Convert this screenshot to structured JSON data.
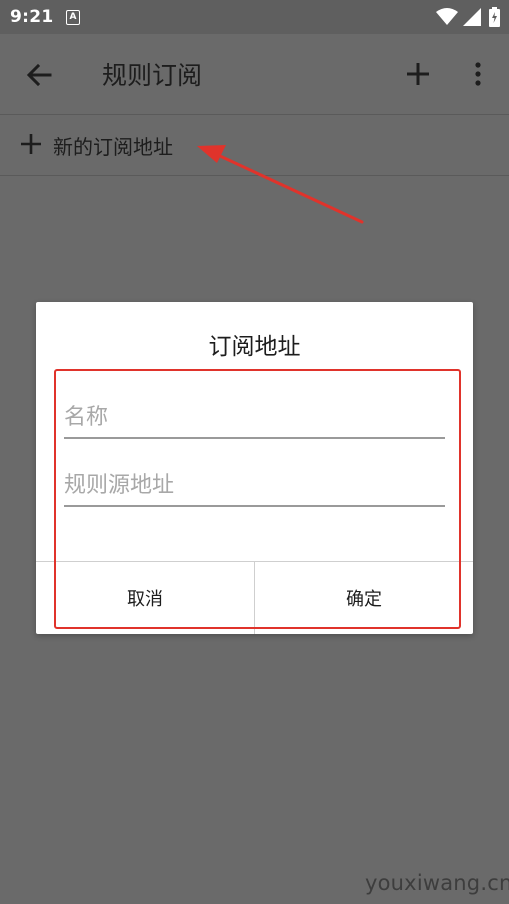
{
  "status_bar": {
    "time": "9:21",
    "notification_icon_letter": "A",
    "icons": [
      "a-notification-icon",
      "wifi-icon",
      "signal-icon",
      "battery-icon"
    ]
  },
  "toolbar": {
    "title": "规则订阅",
    "icons": [
      "back-arrow-icon",
      "plus-icon",
      "more-vert-icon"
    ]
  },
  "list": {
    "new_subscription_label": "新的订阅地址",
    "icons": [
      "plus-icon"
    ]
  },
  "dialog": {
    "title": "订阅地址",
    "name_placeholder": "名称",
    "url_placeholder": "规则源地址",
    "cancel_label": "取消",
    "confirm_label": "确定"
  },
  "watermark": "youxiwang.cn",
  "colors": {
    "overlay_gray": "#6a6a6a",
    "annotation_red": "#e0332b",
    "dialog_bg": "#ffffff"
  }
}
